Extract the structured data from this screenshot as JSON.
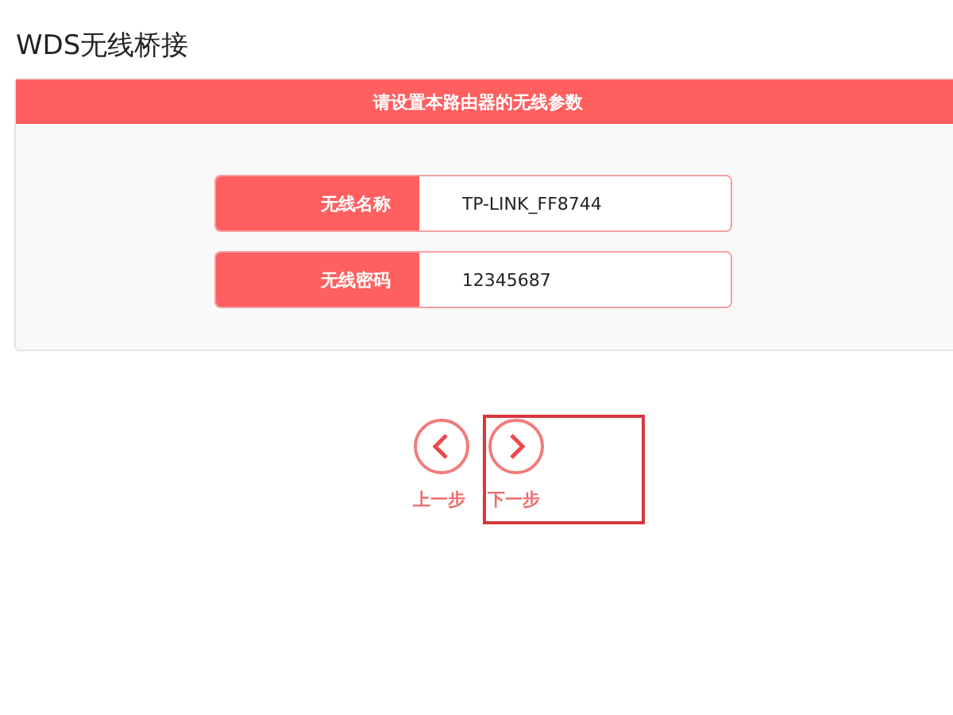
{
  "title": "WDS无线桥接",
  "panel": {
    "header": "请设置本路由器的无线参数",
    "fields": [
      {
        "label": "无线名称",
        "value": "TP-LINK_FF8744"
      },
      {
        "label": "无线密码",
        "value": "12345687"
      }
    ]
  },
  "nav": [
    {
      "kind": "prev",
      "label": "上一步",
      "highlighted": false
    },
    {
      "kind": "next",
      "label": "下一步",
      "highlighted": true
    }
  ]
}
